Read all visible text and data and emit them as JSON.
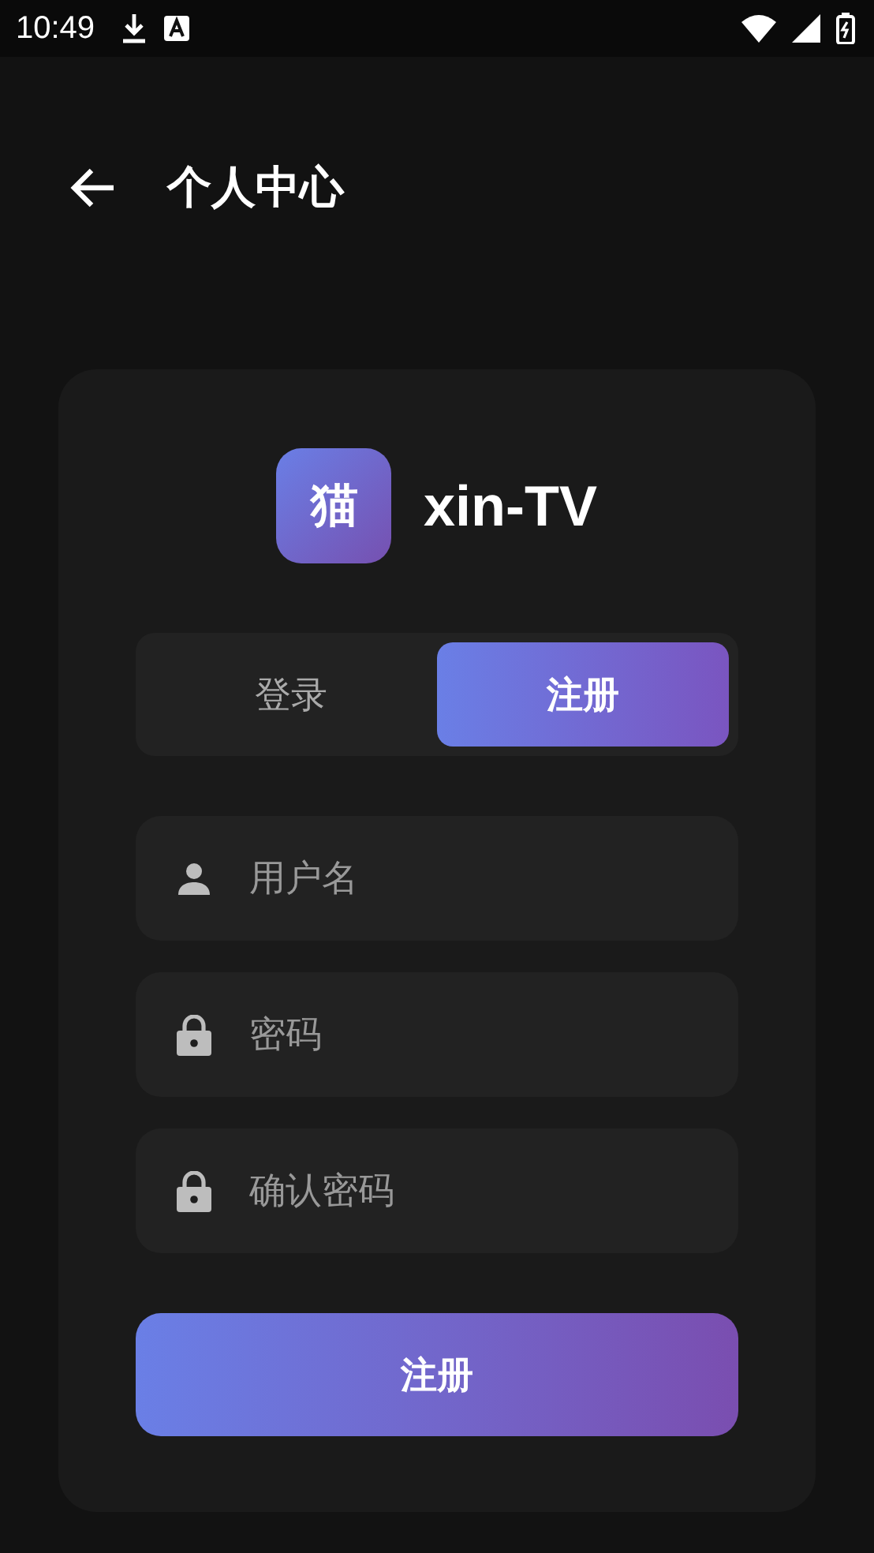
{
  "status_bar": {
    "time": "10:49"
  },
  "header": {
    "title": "个人中心"
  },
  "app": {
    "logo_char": "猫",
    "name": "xin-TV"
  },
  "tabs": [
    {
      "label": "登录",
      "selected": false
    },
    {
      "label": "注册",
      "selected": true
    }
  ],
  "fields": [
    {
      "kind": "user",
      "placeholder": "用户名"
    },
    {
      "kind": "lock",
      "placeholder": "密码"
    },
    {
      "kind": "lock",
      "placeholder": "确认密码"
    }
  ],
  "submit_button": {
    "label": "注册"
  }
}
